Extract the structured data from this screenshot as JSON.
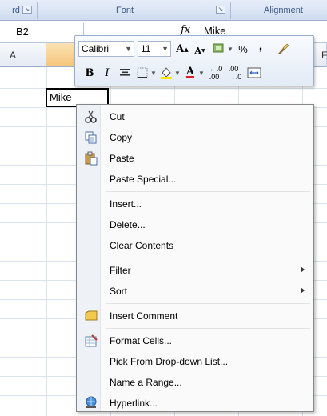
{
  "ribbon": {
    "group_clipboard_partial": "rd",
    "group_font": "Font",
    "group_alignment": "Alignment"
  },
  "formula_bar": {
    "name_box": "B2",
    "fx_label": "fx",
    "content": "Mike"
  },
  "grid": {
    "col_a": "A",
    "col_f_partial": "F",
    "cell_b2_value": "Mike"
  },
  "mini_toolbar": {
    "font_name": "Calibri",
    "font_size": "11",
    "icons": [
      "grow-font-icon",
      "shrink-font-icon",
      "format-painter-icon",
      "percent-icon",
      "comma-icon",
      "bold-icon",
      "italic-icon",
      "align-center-icon",
      "borders-icon",
      "fill-color-icon",
      "font-color-icon",
      "increase-decimal-icon",
      "decrease-decimal-icon",
      "merge-center-icon"
    ],
    "bold": "B",
    "italic": "I",
    "percent": "%",
    "comma": ",",
    "colors": {
      "fill": "#ffe600",
      "font": "#e02020"
    }
  },
  "context_menu": {
    "items": [
      {
        "label": "Cut",
        "icon": "scissors-icon"
      },
      {
        "label": "Copy",
        "icon": "copy-icon"
      },
      {
        "label": "Paste",
        "icon": "paste-icon"
      },
      {
        "label": "Paste Special..."
      },
      {
        "label": "Insert..."
      },
      {
        "label": "Delete..."
      },
      {
        "label": "Clear Contents"
      },
      {
        "label": "Filter",
        "submenu": true
      },
      {
        "label": "Sort",
        "submenu": true
      },
      {
        "label": "Insert Comment",
        "icon": "comment-icon"
      },
      {
        "label": "Format Cells...",
        "icon": "format-cells-icon"
      },
      {
        "label": "Pick From Drop-down List..."
      },
      {
        "label": "Name a Range..."
      },
      {
        "label": "Hyperlink...",
        "icon": "hyperlink-icon"
      }
    ]
  }
}
